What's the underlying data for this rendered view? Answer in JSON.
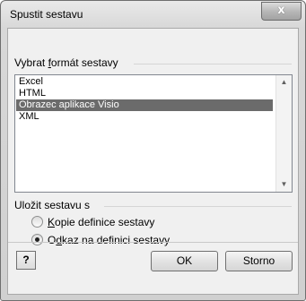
{
  "window": {
    "title": "Spustit sestavu",
    "close_label": "x"
  },
  "format_group": {
    "label_before": "Vybrat ",
    "label_underlined": "f",
    "label_after": "ormát sestavy",
    "items": [
      {
        "label": "Excel",
        "selected": false
      },
      {
        "label": "HTML",
        "selected": false
      },
      {
        "label": "Obrazec aplikace Visio",
        "selected": true
      },
      {
        "label": "XML",
        "selected": false
      }
    ]
  },
  "save_group": {
    "label": "Uložit sestavu s",
    "options": [
      {
        "label_underlined": "K",
        "label_after": "opie definice sestavy",
        "checked": false
      },
      {
        "label_before": "O",
        "label_underlined": "d",
        "label_after": "kaz na definici sestavy",
        "checked": true
      }
    ]
  },
  "buttons": {
    "help": "?",
    "ok": "OK",
    "cancel": "Storno"
  }
}
